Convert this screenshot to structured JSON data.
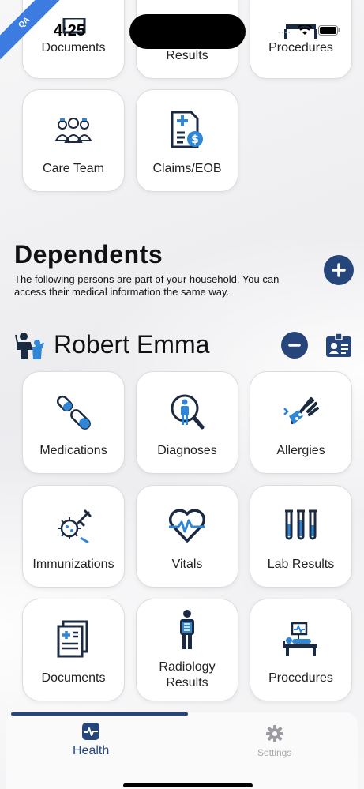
{
  "status_bar": {
    "time": "4:25"
  },
  "qa_badge": "QA",
  "top_tiles": [
    {
      "label": "Documents",
      "icon": "documents-icon"
    },
    {
      "label": "Results",
      "icon": "results-icon"
    },
    {
      "label": "Procedures",
      "icon": "procedures-icon"
    }
  ],
  "second_tiles": [
    {
      "label": "Care Team",
      "icon": "care-team-icon"
    },
    {
      "label": "Claims/EOB",
      "icon": "claims-icon"
    }
  ],
  "dependents": {
    "title": "Dependents",
    "description": "The following persons are part of your household. You can access their medical information the same way."
  },
  "dependent": {
    "name": "Robert Emma",
    "tiles": [
      {
        "label": "Medications",
        "icon": "medications-icon"
      },
      {
        "label": "Diagnoses",
        "icon": "diagnoses-icon"
      },
      {
        "label": "Allergies",
        "icon": "allergies-icon"
      },
      {
        "label": "Immunizations",
        "icon": "immunizations-icon"
      },
      {
        "label": "Vitals",
        "icon": "vitals-icon"
      },
      {
        "label": "Lab Results",
        "icon": "lab-results-icon"
      },
      {
        "label": "Documents",
        "icon": "documents-icon"
      },
      {
        "label": "Radiology\nResults",
        "icon": "radiology-icon"
      },
      {
        "label": "Procedures",
        "icon": "procedures-icon"
      }
    ]
  },
  "bottom_nav": {
    "health": "Health",
    "settings": "Settings"
  },
  "colors": {
    "brand": "#26457b",
    "accent_blue": "#2f86d6"
  }
}
